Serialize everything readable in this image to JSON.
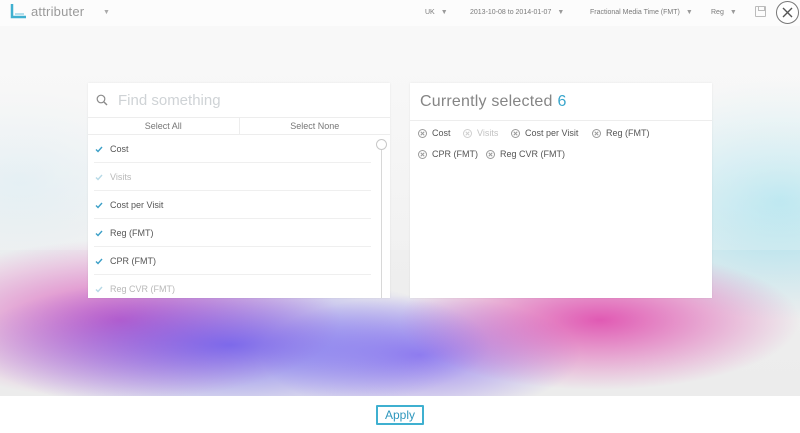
{
  "topbar": {
    "logo_text": "attributer",
    "region": "UK",
    "date_range": "2013-10-08 to 2014-01-07",
    "model": "Fractional Media Time (FMT)",
    "metric": "Reg",
    "caret": "▼"
  },
  "search": {
    "placeholder": "Find something",
    "value": ""
  },
  "select_all_label": "Select All",
  "select_none_label": "Select None",
  "metrics_list": [
    {
      "label": "Cost",
      "checked": true,
      "dim": false
    },
    {
      "label": "Visits",
      "checked": true,
      "dim": true
    },
    {
      "label": "Cost per Visit",
      "checked": true,
      "dim": false
    },
    {
      "label": "Reg (FMT)",
      "checked": true,
      "dim": false
    },
    {
      "label": "CPR (FMT)",
      "checked": true,
      "dim": false
    },
    {
      "label": "Reg CVR (FMT)",
      "checked": true,
      "dim": true
    }
  ],
  "selected_panel": {
    "title": "Currently selected",
    "count": "6",
    "chips": [
      {
        "label": "Cost",
        "dim": false
      },
      {
        "label": "Visits",
        "dim": true
      },
      {
        "label": "Cost per Visit",
        "dim": false
      },
      {
        "label": "Reg (FMT)",
        "dim": false
      },
      {
        "label": "CPR (FMT)",
        "dim": false
      },
      {
        "label": "Reg CVR (FMT)",
        "dim": false
      }
    ]
  },
  "apply_label": "Apply",
  "colors": {
    "accent": "#3aa6cc",
    "checkmark": "#3b9fc7"
  }
}
